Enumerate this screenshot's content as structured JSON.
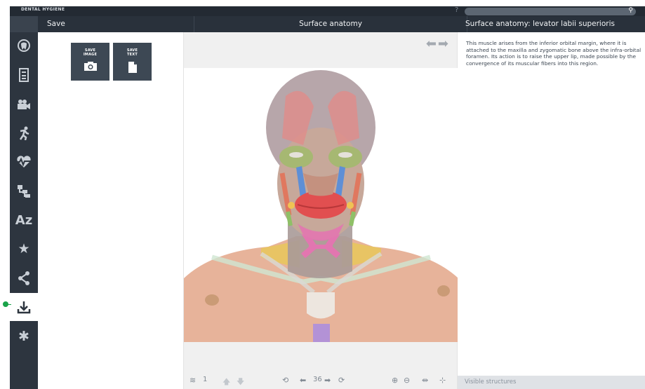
{
  "app": {
    "title": "DENTAL HYGIENE",
    "help": "?"
  },
  "header": {
    "save": "Save",
    "center": "Surface anatomy",
    "info": "Surface anatomy: levator labii superioris"
  },
  "save_panel": {
    "image_label": [
      "SAVE",
      "IMAGE"
    ],
    "text_label": [
      "SAVE",
      "TEXT"
    ]
  },
  "sidebar": {
    "items": [
      {
        "icon": "tooth-icon"
      },
      {
        "icon": "book-icon"
      },
      {
        "icon": "video-icon"
      },
      {
        "icon": "running-person-icon"
      },
      {
        "icon": "heartbeat-icon"
      },
      {
        "icon": "hierarchy-icon"
      },
      {
        "icon": "az-icon",
        "text": "Az"
      },
      {
        "icon": "star-icon"
      },
      {
        "icon": "share-icon"
      },
      {
        "icon": "download-icon",
        "active": true
      },
      {
        "icon": "gear-icon"
      }
    ]
  },
  "info": {
    "description": "This muscle arises from the inferior orbital margin, where it is attached to the maxilla and zygomatic bone above the infra-orbital foramen. Its action is to raise the upper lip, made possible by the convergence of its muscular fibers into this region.",
    "visible_structures": "Visible structures"
  },
  "toolbar": {
    "layer_count": "1",
    "rotation_steps": "36"
  }
}
